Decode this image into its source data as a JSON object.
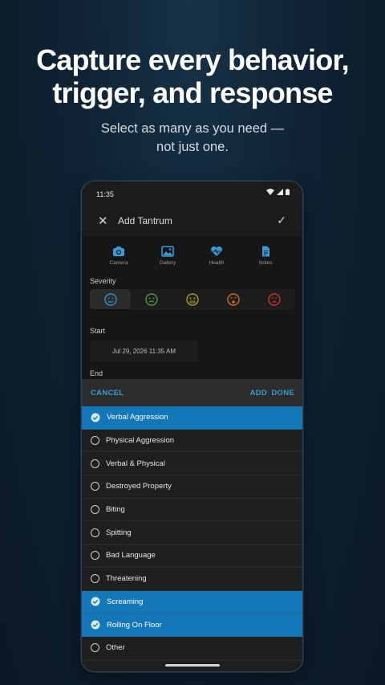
{
  "hero": {
    "headline_line1": "Capture every behavior,",
    "headline_line2": "trigger, and response",
    "subhead_line1": "Select as many as you need —",
    "subhead_line2": "not just one."
  },
  "status_bar": {
    "time": "11:35",
    "icons": [
      "wifi-icon",
      "signal-icon",
      "battery-icon"
    ]
  },
  "app_bar": {
    "title": "Add Tantrum",
    "close_icon": "close-icon",
    "confirm_icon": "check-icon"
  },
  "attachments": [
    {
      "label": "Camera",
      "icon": "camera-icon"
    },
    {
      "label": "Gallery",
      "icon": "gallery-icon"
    },
    {
      "label": "Health",
      "icon": "health-icon"
    },
    {
      "label": "Notes",
      "icon": "notes-icon"
    }
  ],
  "severity": {
    "label": "Severity",
    "levels": [
      {
        "icon": "face-calm-icon",
        "color": "#2e8fd0",
        "selected": true
      },
      {
        "icon": "face-neutral-icon",
        "color": "#4c9a3b",
        "selected": false
      },
      {
        "icon": "face-worried-icon",
        "color": "#a79a25",
        "selected": false
      },
      {
        "icon": "face-upset-icon",
        "color": "#cf6a1f",
        "selected": false
      },
      {
        "icon": "face-angry-icon",
        "color": "#c73530",
        "selected": false
      }
    ]
  },
  "start": {
    "label": "Start",
    "value": "Jul 29, 2026 11:35 AM"
  },
  "end": {
    "label": "End"
  },
  "sheet": {
    "cancel": "CANCEL",
    "add": "ADD",
    "done": "DONE",
    "options": [
      {
        "label": "Verbal Aggression",
        "selected": true
      },
      {
        "label": "Physical Aggression",
        "selected": false
      },
      {
        "label": "Verbal & Physical",
        "selected": false
      },
      {
        "label": "Destroyed Property",
        "selected": false
      },
      {
        "label": "Biting",
        "selected": false
      },
      {
        "label": "Spitting",
        "selected": false
      },
      {
        "label": "Bad Language",
        "selected": false
      },
      {
        "label": "Threatening",
        "selected": false
      },
      {
        "label": "Screaming",
        "selected": true
      },
      {
        "label": "Rolling On Floor",
        "selected": true
      },
      {
        "label": "Other",
        "selected": false
      }
    ]
  },
  "colors": {
    "accent": "#3a9ad6",
    "selected_row": "#1477b8",
    "background": "#0f2233"
  }
}
